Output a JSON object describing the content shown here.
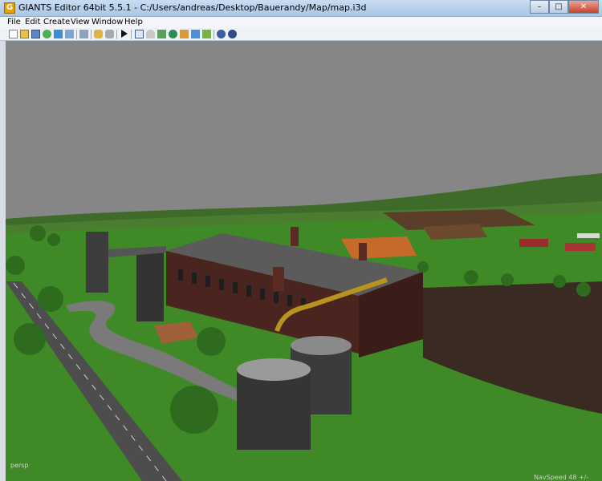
{
  "window": {
    "title": "GIANTS Editor 64bit 5.5.1 - C:/Users/andreas/Desktop/Bauerandy/Map/map.i3d",
    "app_icon_letter": "G",
    "minimize_glyph": "–",
    "maximize_glyph": "□",
    "close_glyph": "✕"
  },
  "menu": {
    "items": [
      "File",
      "Edit",
      "Create",
      "View",
      "Window",
      "Help"
    ]
  },
  "toolbar": {
    "icons": [
      "new-file-icon",
      "open-folder-icon",
      "save-icon",
      "refresh-icon",
      "import-icon",
      "export-icon",
      "settings-icon",
      "undo-icon",
      "redo-icon",
      "play-icon",
      "select-tool-icon",
      "magnet-icon",
      "terrain-icon",
      "foliage-icon",
      "paint-icon",
      "decal-icon",
      "object-icon",
      "gear-icon",
      "gear-alt-icon"
    ]
  },
  "viewport": {
    "sky_color": "#868686",
    "corner_label": "persp",
    "status_text": "NavSpeed 48 +/-"
  }
}
